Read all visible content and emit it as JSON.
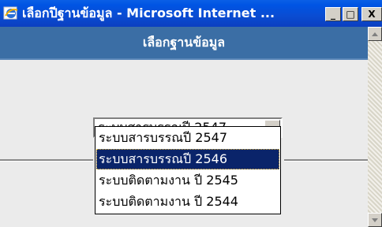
{
  "window": {
    "title": "เลือกปีฐานข้อมูล - Microsoft Internet ...",
    "icon": "internet-explorer-icon",
    "minimize_glyph": "_",
    "maximize_glyph": "□",
    "close_glyph": "X"
  },
  "header": {
    "title": "เลือกฐานข้อมูล",
    "band_color": "#3b6ea5"
  },
  "database_select": {
    "selected_value": "ระบบสารบรรณปี 2547",
    "options": [
      {
        "label": "ระบบสารบรรณปี 2547",
        "highlighted": false
      },
      {
        "label": "ระบบสารบรรณปี 2546",
        "highlighted": true
      },
      {
        "label": "ระบบติดตามงาน ปี 2545",
        "highlighted": false
      },
      {
        "label": "ระบบติดตามงาน ปี 2544",
        "highlighted": false
      }
    ],
    "highlight_color": "#0a246a"
  }
}
